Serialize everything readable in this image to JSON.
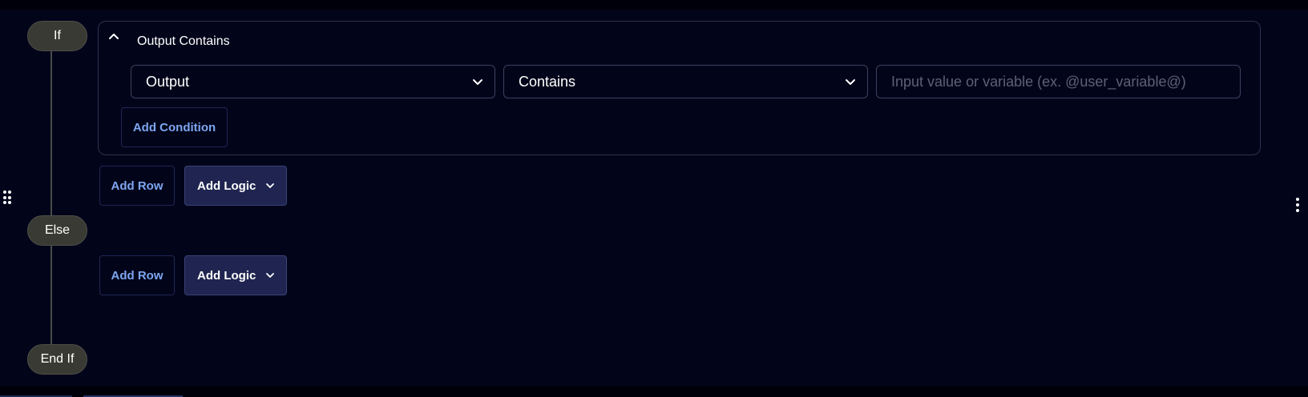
{
  "flow": {
    "if_label": "If",
    "else_label": "Else",
    "endif_label": "End If"
  },
  "condition_group": {
    "title": "Output Contains",
    "field_select": {
      "selected": "Output"
    },
    "operator_select": {
      "selected": "Contains"
    },
    "value_input": {
      "value": "",
      "placeholder": "Input value or variable (ex. @user_variable@)"
    },
    "add_condition_label": "Add Condition"
  },
  "if_actions": {
    "add_row_label": "Add Row",
    "add_logic_label": "Add Logic"
  },
  "else_actions": {
    "add_row_label": "Add Row",
    "add_logic_label": "Add Logic"
  },
  "icons": {
    "collapse": "chevron-up-icon",
    "dropdown": "chevron-down-icon",
    "drag": "drag-handle-icon",
    "menu": "kebab-menu-icon"
  },
  "colors": {
    "background": "#02051a",
    "pill": "#3a3a34",
    "link_text": "#7ea6f0",
    "button_fill": "#1f2550"
  }
}
